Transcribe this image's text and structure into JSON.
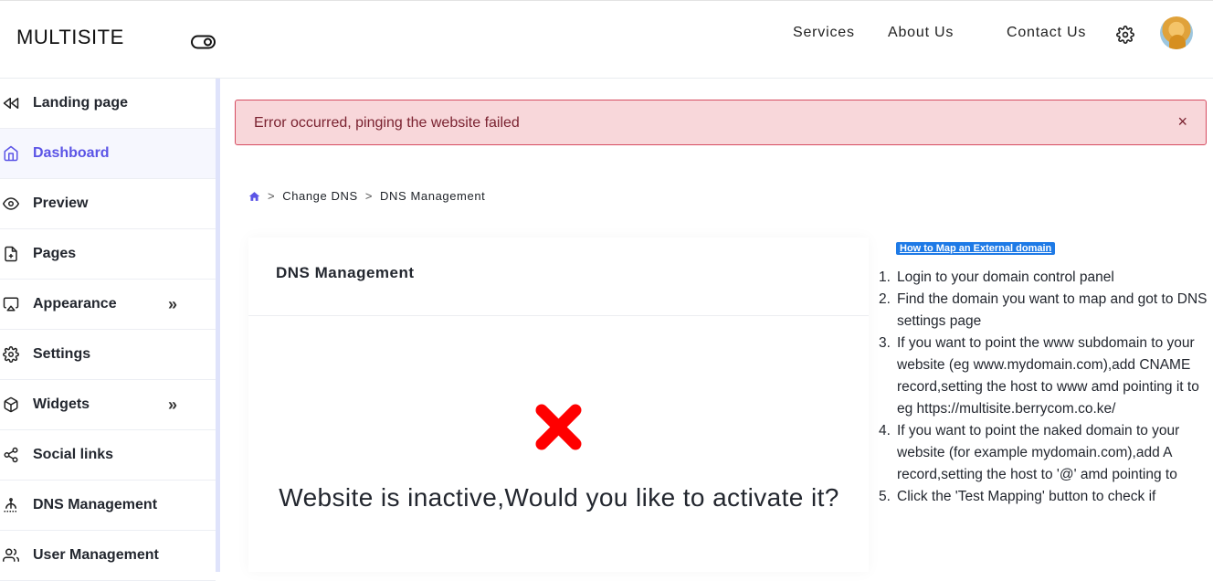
{
  "header": {
    "brand": "MULTISITE",
    "nav": [
      "Services",
      "About Us",
      "Contact Us"
    ]
  },
  "sidebar": {
    "items": [
      {
        "label": "Landing page",
        "icon": "rewind-icon"
      },
      {
        "label": "Dashboard",
        "icon": "home-icon",
        "active": true
      },
      {
        "label": "Preview",
        "icon": "eye-icon"
      },
      {
        "label": "Pages",
        "icon": "file-plus-icon"
      },
      {
        "label": "Appearance",
        "icon": "airplay-icon",
        "expandable": true
      },
      {
        "label": "Settings",
        "icon": "gear-icon"
      },
      {
        "label": "Widgets",
        "icon": "box-icon",
        "expandable": true
      },
      {
        "label": "Social links",
        "icon": "share-icon"
      },
      {
        "label": "DNS Management",
        "icon": "signal-icon"
      },
      {
        "label": "User Management",
        "icon": "users-icon"
      }
    ]
  },
  "alert": {
    "message": "Error occurred, pinging the website failed",
    "close": "×"
  },
  "breadcrumb": {
    "items": [
      "Change DNS",
      "DNS Management"
    ],
    "separator": ">"
  },
  "card": {
    "title": "DNS Management",
    "message": "Website is inactive,Would you like to activate it?"
  },
  "howto": {
    "badge": "How to Map an External domain",
    "steps": [
      "Login to your domain control panel",
      "Find the domain you want to map and got to DNS settings page",
      "If you want to point the www subdomain to your website (eg www.mydomain.com),add CNAME record,setting the host to www amd pointing it to eg https://multisite.berrycom.co.ke/",
      "If you want to point the naked domain to your website (for example mydomain.com),add A record,setting the host to '@' amd pointing to",
      "Click the 'Test Mapping' button to check if"
    ]
  },
  "colors": {
    "accent": "#5b54e6",
    "alert_bg": "#f8d7da",
    "alert_border": "#d64b60",
    "badge": "#1e7ae6",
    "error_red": "#ff0000"
  }
}
